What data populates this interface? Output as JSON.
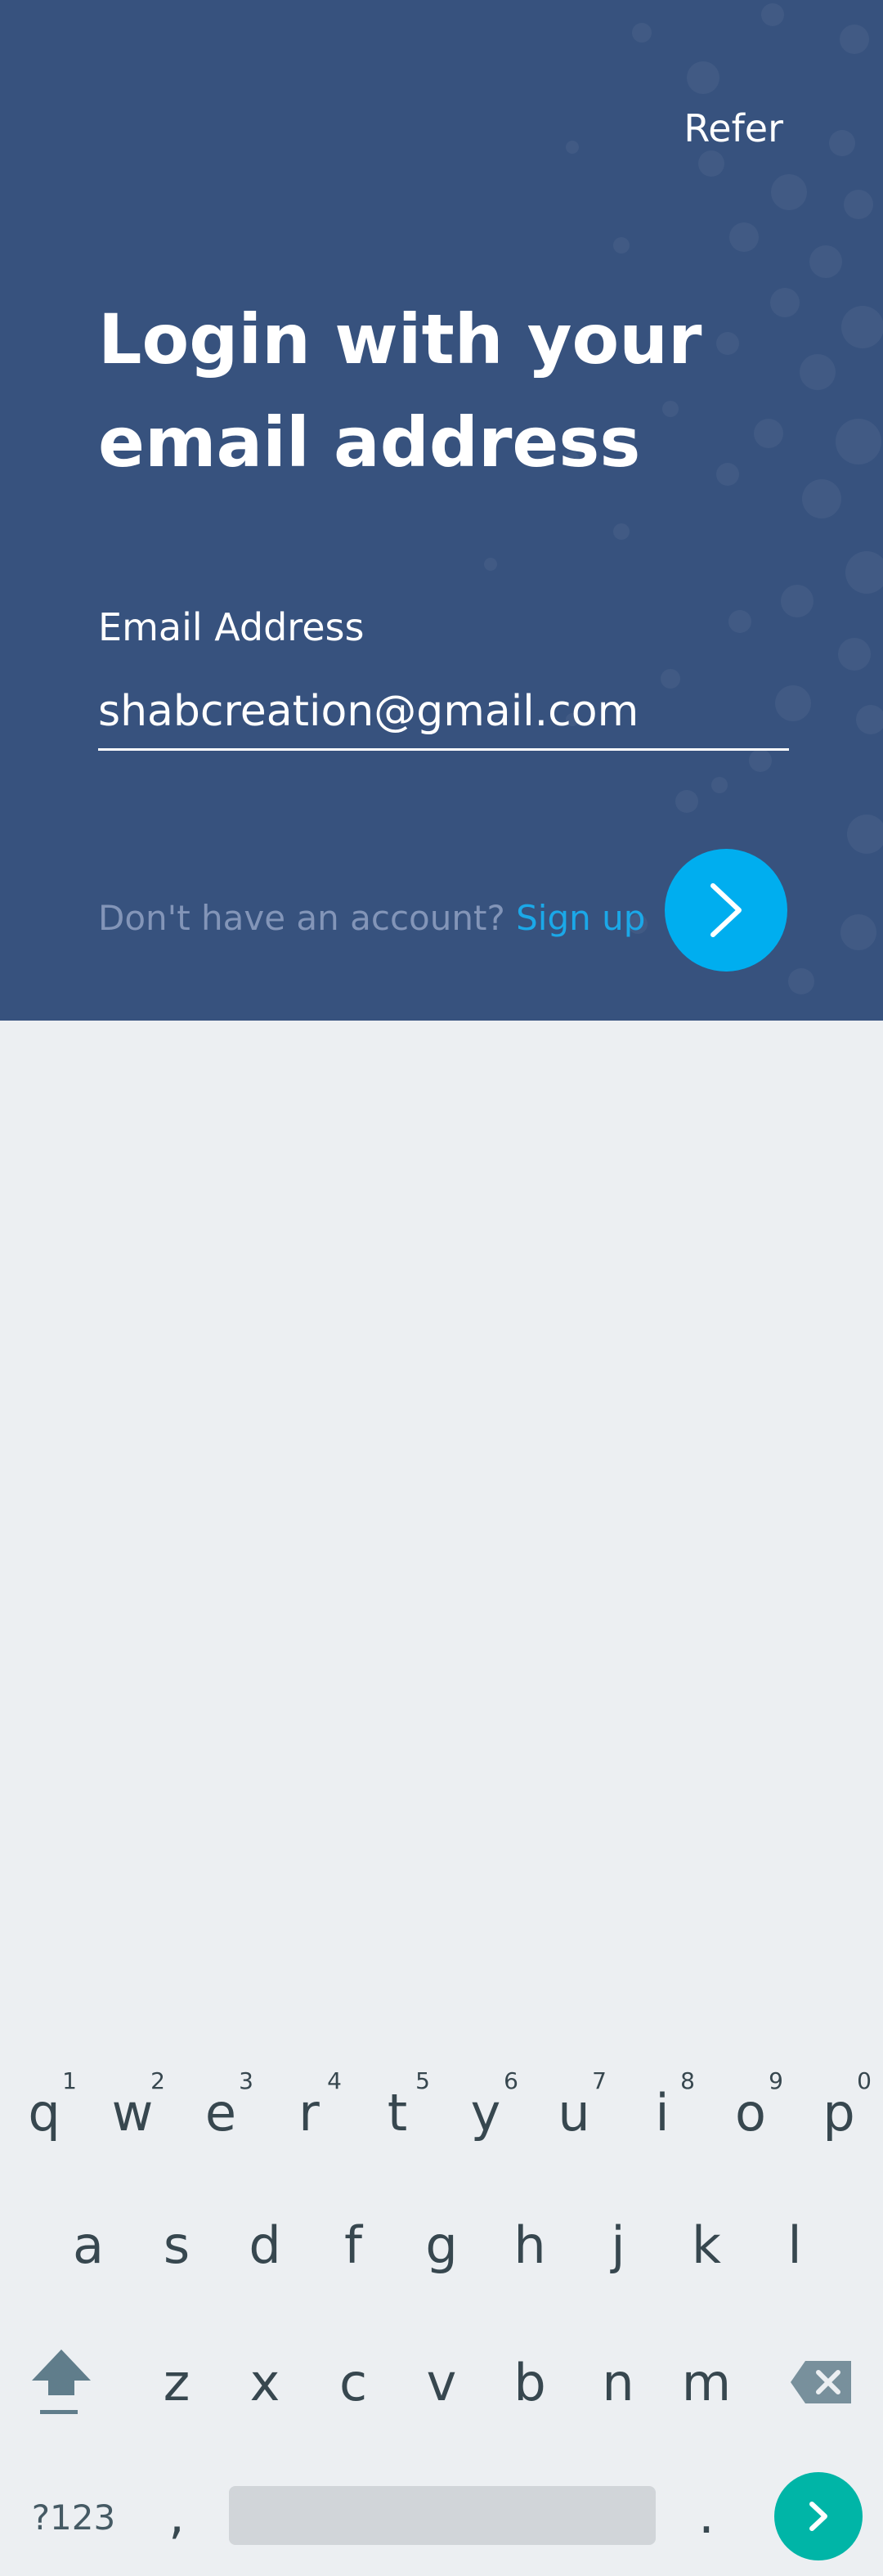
{
  "header": {
    "refer_label": "Refer"
  },
  "login": {
    "title": "Login with your email address",
    "email_label": "Email Address",
    "email_value": "shabcreation@gmail.com",
    "signup_prompt": "Don't have an account?",
    "signup_link": "Sign up"
  },
  "colors": {
    "background": "#37527E",
    "accent": "#00AEEF",
    "enter_key": "#00B5A7"
  },
  "icons": {
    "next": "chevron-right-icon",
    "shift": "shift-arrow-icon",
    "backspace": "backspace-icon",
    "enter": "chevron-right-icon"
  },
  "keyboard": {
    "row1": [
      "q",
      "w",
      "e",
      "r",
      "t",
      "y",
      "u",
      "i",
      "o",
      "p"
    ],
    "row1_hints": [
      "1",
      "2",
      "3",
      "4",
      "5",
      "6",
      "7",
      "8",
      "9",
      "0"
    ],
    "row2": [
      "a",
      "s",
      "d",
      "f",
      "g",
      "h",
      "j",
      "k",
      "l"
    ],
    "row3": [
      "z",
      "x",
      "c",
      "v",
      "b",
      "n",
      "m"
    ],
    "symbols_label": "?123",
    "comma": ",",
    "period": "."
  }
}
